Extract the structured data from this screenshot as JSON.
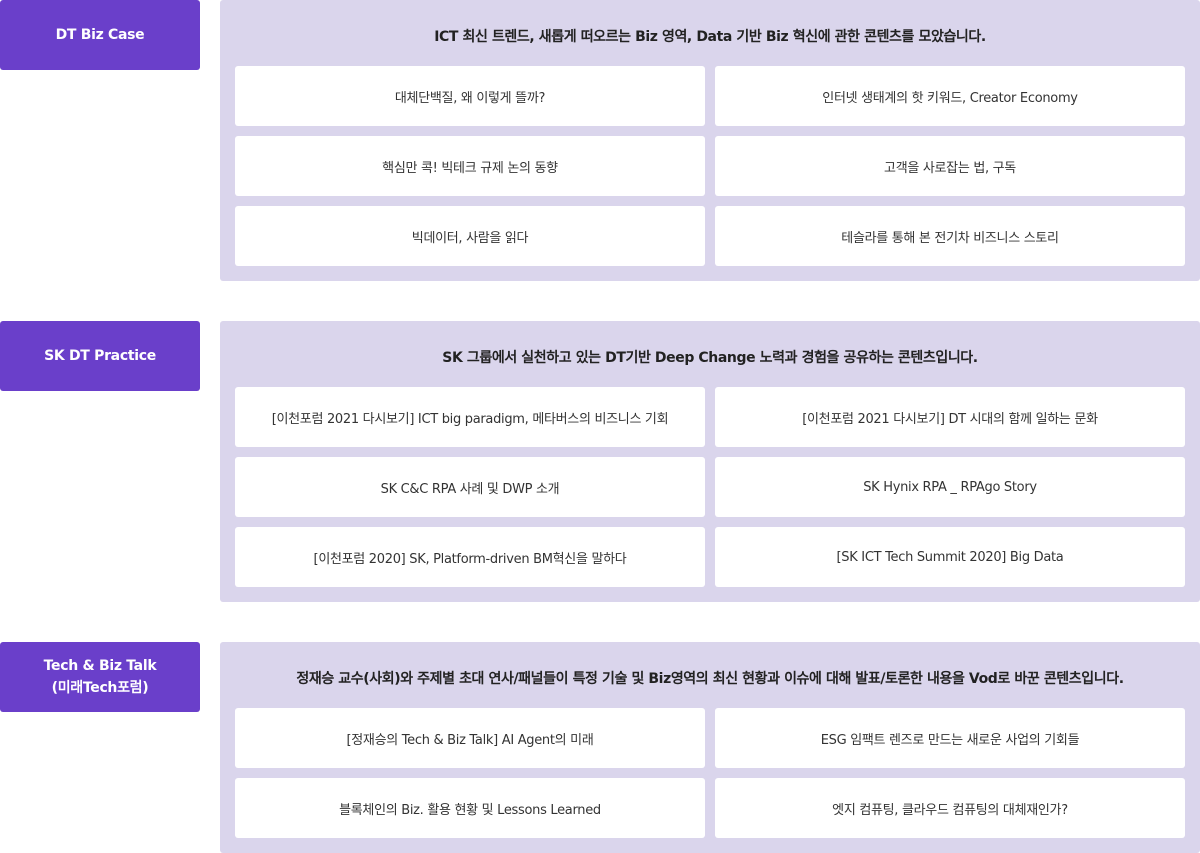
{
  "sections": [
    {
      "tag": "DT Biz Case",
      "description": "ICT 최신 트렌드, 새롭게 떠오르는 Biz 영역, Data 기반 Biz 혁신에 관한 콘텐츠를 모았습니다.",
      "cards": [
        "대체단백질, 왜 이렇게 뜰까?",
        "인터넷 생태계의 핫 키워드, Creator Economy",
        "핵심만 콕! 빅테크 규제 논의 동향",
        "고객을 사로잡는 법, 구독",
        "빅데이터, 사람을 읽다",
        "테슬라를 통해 본 전기차 비즈니스 스토리"
      ]
    },
    {
      "tag": "SK DT Practice",
      "description": "SK 그룹에서 실천하고 있는 DT기반 Deep Change 노력과 경험을 공유하는 콘텐츠입니다.",
      "cards": [
        "[이천포럼 2021 다시보기] ICT big paradigm, 메타버스의 비즈니스 기회",
        "[이천포럼 2021 다시보기] DT 시대의 함께 일하는 문화",
        "SK C&C RPA 사례 및 DWP 소개",
        "SK Hynix RPA _ RPAgo Story",
        "[이천포럼 2020] SK, Platform-driven BM혁신을 말하다",
        "[SK ICT Tech Summit 2020] Big Data"
      ]
    },
    {
      "tag": "Tech & Biz Talk\n(미래Tech포럼)",
      "description": "정재승 교수(사회)와 주제별 초대 연사/패널들이 특정 기술 및 Biz영역의 최신 현황과 이슈에 대해 발표/토론한 내용을 Vod로 바꾼 콘텐츠입니다.",
      "cards": [
        "[정재승의 Tech & Biz Talk] AI Agent의 미래",
        "ESG 임팩트 렌즈로 만드는 새로운 사업의 기회들",
        "블록체인의 Biz. 활용 현황 및 Lessons Learned",
        "엣지 컴퓨팅, 클라우드 컴퓨팅의 대체재인가?"
      ]
    }
  ],
  "colors": {
    "tag_bg": "#6a3fca",
    "panel_bg": "#dad5ec",
    "card_bg": "#ffffff"
  }
}
